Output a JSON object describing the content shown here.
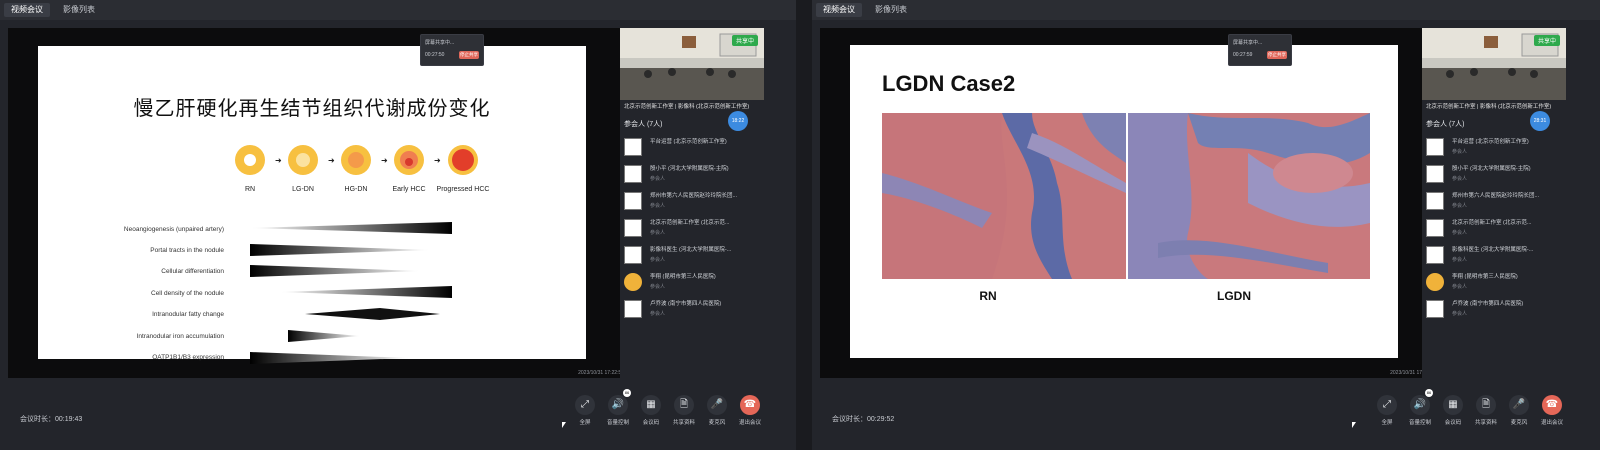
{
  "tabs": [
    "视频会议",
    "影像列表"
  ],
  "left": {
    "share_popup": {
      "status": "屏幕共享中...",
      "time": "00:27:50",
      "stop_label": "停止共享"
    },
    "slide_timestamp": "2023/10/31 17:22:58",
    "slide": {
      "title": "慢乙肝硬化再生结节组织代谢成份变化",
      "stages": [
        "RN",
        "LG-DN",
        "HG-DN",
        "Early HCC",
        "Progressed HCC"
      ],
      "features": [
        "Neoangiogenesis (unpaired artery)",
        "Portal tracts in the nodule",
        "Cellular differentiation",
        "Cell density of the nodule",
        "Intranodular fatty change",
        "Intranodular iron accumulation",
        "OATP1B1/B3 expression"
      ]
    },
    "camera": {
      "sharing_badge": "共享中",
      "caption": "北京示范创新工作室 | 影像科 (北京示范创新工作室)"
    },
    "timer_bubble": "18:22",
    "participants_header": "参会人 (7人)",
    "participants": [
      {
        "name": "平台运营 (北京示范创新工作室)",
        "role": "",
        "avatar": "blank"
      },
      {
        "name": "殷小平 (河北大学附属医院-主院)",
        "role": "参会人",
        "avatar": "blank"
      },
      {
        "name": "郑州市第六人民医院赵玲玲院长团...",
        "role": "参会人",
        "avatar": "blank"
      },
      {
        "name": "北京示范创新工作室 (北京示范...",
        "role": "参会人",
        "avatar": "blank"
      },
      {
        "name": "影像科医生 (河北大学附属医院-...",
        "role": "参会人",
        "avatar": "blank"
      },
      {
        "name": "李翔 (昆明市第三人民医院)",
        "role": "参会人",
        "avatar": "face"
      },
      {
        "name": "卢乔波 (南宁市第四人民医院)",
        "role": "参会人",
        "avatar": "blank"
      }
    ],
    "duration": "会议时长：00:19:43",
    "controls": [
      {
        "label": "全屏",
        "icon": "expand-icon",
        "glyph": "⤢"
      },
      {
        "label": "音量控制",
        "icon": "speaker-icon",
        "glyph": "🔊",
        "badge": "86"
      },
      {
        "label": "会议码",
        "icon": "qrcode-icon",
        "glyph": "▦"
      },
      {
        "label": "共享资料",
        "icon": "document-icon",
        "glyph": "🗎"
      },
      {
        "label": "麦克风",
        "icon": "microphone-icon",
        "glyph": "🎤"
      },
      {
        "label": "退出会议",
        "icon": "hangup-icon",
        "glyph": "☎"
      }
    ]
  },
  "right": {
    "share_popup": {
      "status": "屏幕共享中...",
      "time": "00:27:59",
      "stop_label": "停止共享"
    },
    "slide_timestamp": "2023/10/31 17:33:20",
    "slide": {
      "title": "LGDN Case2",
      "image_labels": [
        "RN",
        "LGDN"
      ]
    },
    "camera": {
      "sharing_badge": "共享中",
      "caption": "北京示范创新工作室 | 影像科 (北京示范创新工作室)"
    },
    "timer_bubble": "28:31",
    "participants_header": "参会人 (7人)",
    "participants": [
      {
        "name": "平台运营 (北京示范创新工作室)",
        "role": "参会人",
        "avatar": "blank"
      },
      {
        "name": "殷小平 (河北大学附属医院-主院)",
        "role": "参会人",
        "avatar": "blank"
      },
      {
        "name": "郑州市第六人民医院赵玲玲院长团...",
        "role": "参会人",
        "avatar": "blank"
      },
      {
        "name": "北京示范创新工作室 (北京示范...",
        "role": "参会人",
        "avatar": "blank"
      },
      {
        "name": "影像科医生 (河北大学附属医院-...",
        "role": "参会人",
        "avatar": "blank"
      },
      {
        "name": "李翔 (昆明市第三人民医院)",
        "role": "参会人",
        "avatar": "face"
      },
      {
        "name": "卢乔波 (南宁市第四人民医院)",
        "role": "参会人",
        "avatar": "blank"
      }
    ],
    "duration": "会议时长：00:29:52",
    "controls": [
      {
        "label": "全屏",
        "icon": "expand-icon",
        "glyph": "⤢"
      },
      {
        "label": "音量控制",
        "icon": "speaker-icon",
        "glyph": "🔊",
        "badge": "86"
      },
      {
        "label": "会议码",
        "icon": "qrcode-icon",
        "glyph": "▦"
      },
      {
        "label": "共享资料",
        "icon": "document-icon",
        "glyph": "🗎"
      },
      {
        "label": "麦克风",
        "icon": "microphone-icon",
        "glyph": "🎤"
      },
      {
        "label": "退出会议",
        "icon": "hangup-icon",
        "glyph": "☎"
      }
    ]
  }
}
